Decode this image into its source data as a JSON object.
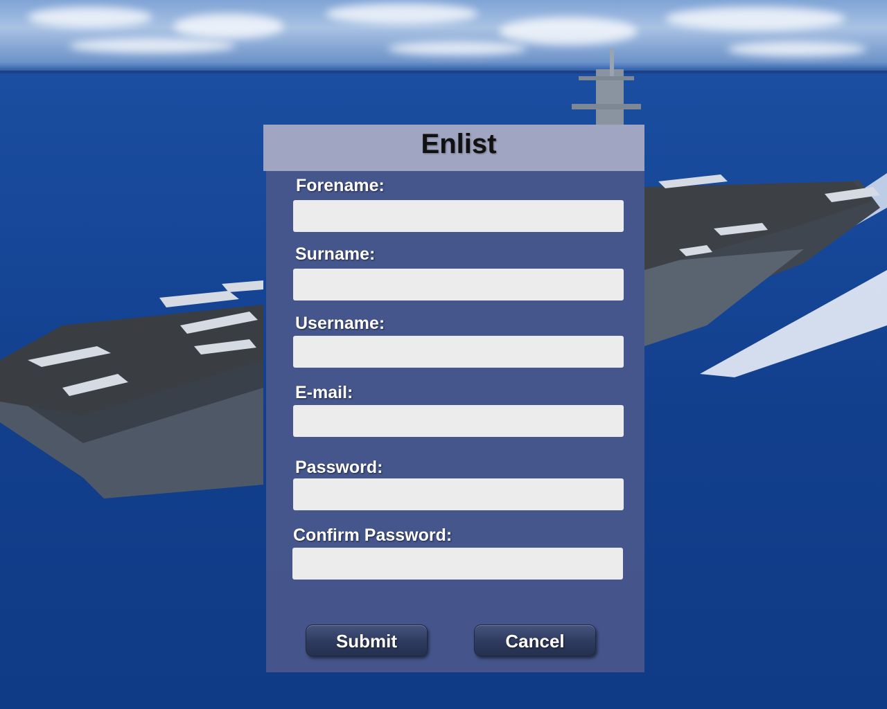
{
  "dialog": {
    "title": "Enlist"
  },
  "fields": {
    "forename": {
      "label": "Forename:",
      "value": ""
    },
    "surname": {
      "label": "Surname:",
      "value": ""
    },
    "username": {
      "label": "Username:",
      "value": ""
    },
    "email": {
      "label": "E-mail:",
      "value": ""
    },
    "password": {
      "label": "Password:",
      "value": ""
    },
    "confirm_password": {
      "label": "Confirm Password:",
      "value": ""
    }
  },
  "buttons": {
    "submit": "Submit",
    "cancel": "Cancel"
  },
  "background": {
    "description_icon": "aircraft-carrier-image",
    "sea_color": "#17489a",
    "sky_color": "#a9c2e3"
  },
  "colors": {
    "panel": "#4a588c",
    "header": "#a5aac4",
    "input": "#ececec",
    "button": "#2e3a5e"
  }
}
